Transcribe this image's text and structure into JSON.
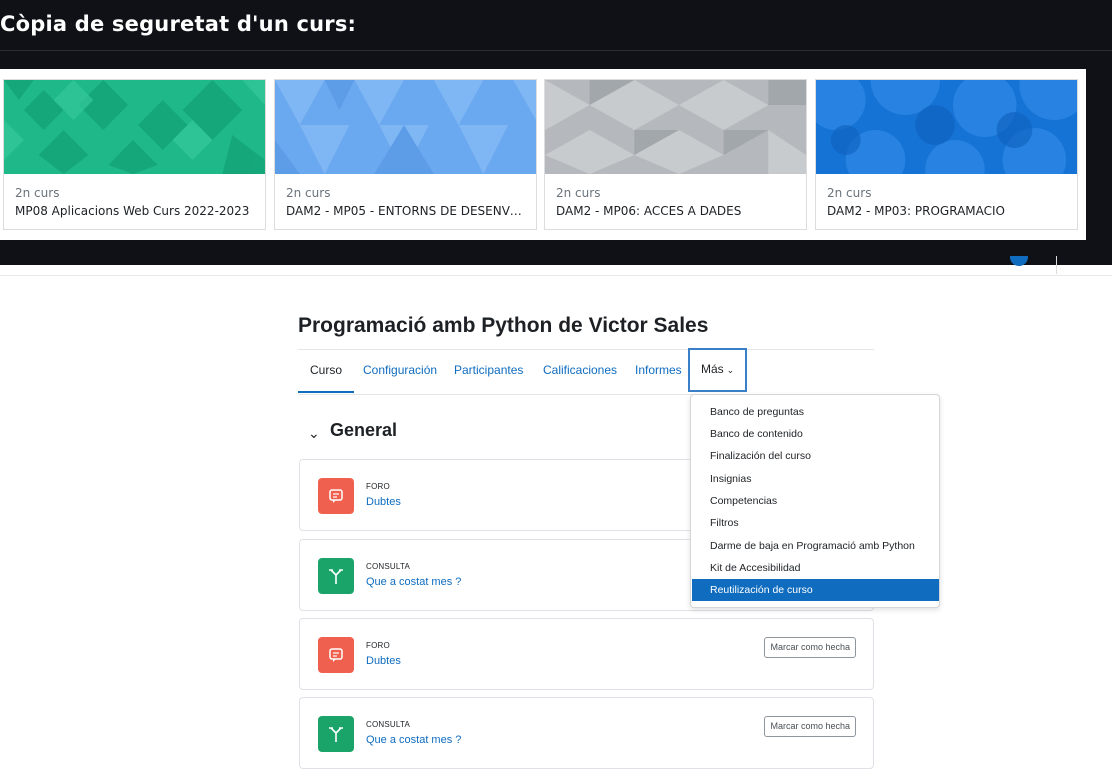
{
  "banner": {
    "title": "Còpia de seguretat d'un curs:",
    "cards": [
      {
        "category": "2n curs",
        "name": "MP08 Aplicacions Web Curs 2022-2023"
      },
      {
        "category": "2n curs",
        "name": "DAM2 - MP05 - ENTORNS DE DESENVOL..."
      },
      {
        "category": "2n curs",
        "name": "DAM2 - MP06: ACCES A DADES"
      },
      {
        "category": "2n curs",
        "name": "DAM2 - MP03: PROGRAMACIO"
      }
    ]
  },
  "course": {
    "title": "Programació amb Python de Victor Sales",
    "tabs": [
      {
        "label": "Curso"
      },
      {
        "label": "Configuración"
      },
      {
        "label": "Participantes"
      },
      {
        "label": "Calificaciones"
      },
      {
        "label": "Informes"
      },
      {
        "label": "Más"
      }
    ],
    "section_title": "General",
    "activities": [
      {
        "type": "FORO",
        "name": "Dubtes",
        "icon": "forum-icon"
      },
      {
        "type": "CONSULTA",
        "name": "Que a costat mes ?",
        "icon": "choice-icon"
      },
      {
        "type": "FORO",
        "name": "Dubtes",
        "icon": "forum-icon",
        "button": "Marcar como hecha"
      },
      {
        "type": "CONSULTA",
        "name": "Que a costat mes ?",
        "icon": "choice-icon",
        "button": "Marcar como hecha"
      }
    ]
  },
  "more_menu": {
    "items": [
      {
        "label": "Banco de preguntas"
      },
      {
        "label": "Banco de contenido"
      },
      {
        "label": "Finalización del curso"
      },
      {
        "label": "Insignias"
      },
      {
        "label": "Competencias"
      },
      {
        "label": "Filtros"
      },
      {
        "label": "Darme de baja en Programació amb Python"
      },
      {
        "label": "Kit de Accesibilidad"
      },
      {
        "label": "Reutilización de curso",
        "selected": true
      }
    ]
  },
  "colors": {
    "brand": "#0f6cbf",
    "forum": "#f0604f",
    "choice": "#1aa469",
    "banner_bg": "#0f1117"
  }
}
